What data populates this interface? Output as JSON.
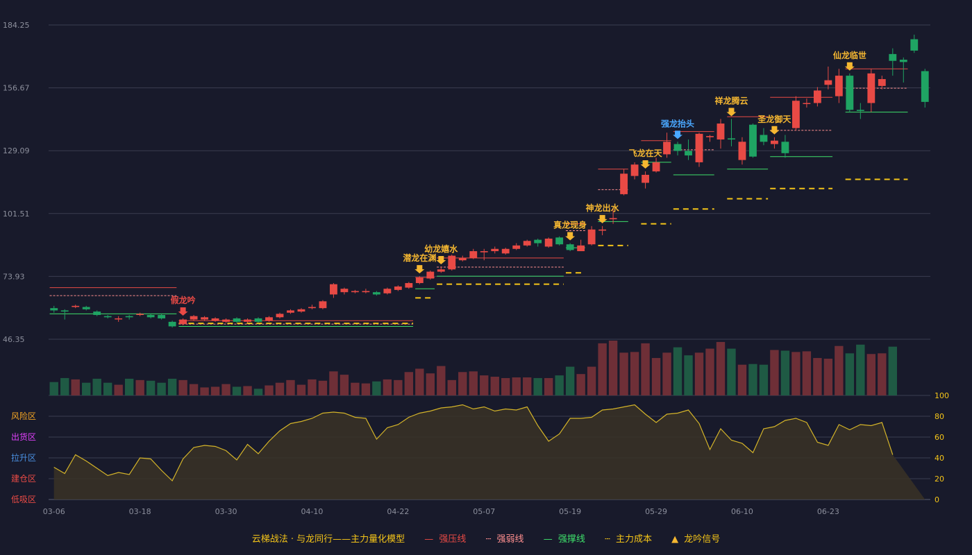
{
  "colors": {
    "up": "#e84a45",
    "down": "#1fa463",
    "signal": "#f5b731",
    "signal_alt": "#4aa8ff",
    "support": "#3ee06b",
    "cost": "#f5c518"
  },
  "chart_data": {
    "type": "candlestick",
    "price_axis": {
      "ticks": [
        46.35,
        73.93,
        101.51,
        129.09,
        156.67,
        184.25
      ],
      "range": [
        46.35,
        184.25
      ]
    },
    "osc_axis": {
      "ticks": [
        0,
        20,
        40,
        60,
        80,
        100
      ],
      "range": [
        0,
        100
      ]
    },
    "zones": [
      "风险区",
      "出货区",
      "拉升区",
      "建仓区",
      "低吸区"
    ],
    "x_ticks": [
      {
        "i": 0,
        "label": "03-06"
      },
      {
        "i": 8,
        "label": "03-18"
      },
      {
        "i": 16,
        "label": "03-30"
      },
      {
        "i": 24,
        "label": "04-10"
      },
      {
        "i": 32,
        "label": "04-22"
      },
      {
        "i": 40,
        "label": "05-07"
      },
      {
        "i": 48,
        "label": "05-19"
      },
      {
        "i": 56,
        "label": "05-29"
      },
      {
        "i": 64,
        "label": "06-10"
      },
      {
        "i": 72,
        "label": "06-23"
      }
    ],
    "candles": [
      [
        60.0,
        59.0,
        61.0,
        58.0
      ],
      [
        59.0,
        58.5,
        59.5,
        55.0
      ],
      [
        60.5,
        61.0,
        61.5,
        60.0
      ],
      [
        60.5,
        59.5,
        61.0,
        59.0
      ],
      [
        58.5,
        57.0,
        59.0,
        56.5
      ],
      [
        56.5,
        56.0,
        57.0,
        55.5
      ],
      [
        55.5,
        55.5,
        56.5,
        54.0
      ],
      [
        56.5,
        56.0,
        57.0,
        55.0
      ],
      [
        57.0,
        57.5,
        58.0,
        56.5
      ],
      [
        57.0,
        56.0,
        57.5,
        55.5
      ],
      [
        57.0,
        55.5,
        57.5,
        55.0
      ],
      [
        54.0,
        52.0,
        54.5,
        51.5
      ],
      [
        53.0,
        55.0,
        55.5,
        52.5
      ],
      [
        55.0,
        56.5,
        57.0,
        54.5
      ],
      [
        55.0,
        56.0,
        56.5,
        54.5
      ],
      [
        54.5,
        55.5,
        56.0,
        54.0
      ],
      [
        54.0,
        55.0,
        55.5,
        53.5
      ],
      [
        55.5,
        54.0,
        56.0,
        53.5
      ],
      [
        54.0,
        55.0,
        55.5,
        53.5
      ],
      [
        55.5,
        54.0,
        56.0,
        53.5
      ],
      [
        54.5,
        56.0,
        56.5,
        54.0
      ],
      [
        56.0,
        57.5,
        58.0,
        55.5
      ],
      [
        58.0,
        59.0,
        59.5,
        57.5
      ],
      [
        58.5,
        59.5,
        60.0,
        58.0
      ],
      [
        60.0,
        60.5,
        61.5,
        59.5
      ],
      [
        60.0,
        63.0,
        63.5,
        59.5
      ],
      [
        66.0,
        70.5,
        71.0,
        64.5
      ],
      [
        67.0,
        68.5,
        69.0,
        66.0
      ],
      [
        67.0,
        67.5,
        68.0,
        66.5
      ],
      [
        67.0,
        67.5,
        68.5,
        66.5
      ],
      [
        67.0,
        66.0,
        67.5,
        65.5
      ],
      [
        66.5,
        68.5,
        69.0,
        66.0
      ],
      [
        68.0,
        69.5,
        70.0,
        67.5
      ],
      [
        69.0,
        71.0,
        71.5,
        68.5
      ],
      [
        71.0,
        73.5,
        74.0,
        70.5
      ],
      [
        73.0,
        76.0,
        76.5,
        72.5
      ],
      [
        76.0,
        77.0,
        78.0,
        75.5
      ],
      [
        77.0,
        83.0,
        83.5,
        76.5
      ],
      [
        81.0,
        82.0,
        83.0,
        80.5
      ],
      [
        82.0,
        85.0,
        86.0,
        81.5
      ],
      [
        84.5,
        85.0,
        86.0,
        81.0
      ],
      [
        85.0,
        86.0,
        87.0,
        84.0
      ],
      [
        84.0,
        86.0,
        86.5,
        83.5
      ],
      [
        86.0,
        87.5,
        88.5,
        85.5
      ],
      [
        87.5,
        89.5,
        90.0,
        87.0
      ],
      [
        90.0,
        88.5,
        90.5,
        87.0
      ],
      [
        87.0,
        90.5,
        91.0,
        86.5
      ],
      [
        91.0,
        88.0,
        91.5,
        87.5
      ],
      [
        88.0,
        85.5,
        88.5,
        85.0
      ],
      [
        85.0,
        87.5,
        90.0,
        85.0
      ],
      [
        88.0,
        94.5,
        96.0,
        87.5
      ],
      [
        94.0,
        94.5,
        96.0,
        92.0
      ],
      [
        99.0,
        99.5,
        104.0,
        97.0
      ],
      [
        110.0,
        119.0,
        121.0,
        109.5
      ],
      [
        118.0,
        123.0,
        124.0,
        116.5
      ],
      [
        115.0,
        118.5,
        120.0,
        112.5
      ],
      [
        120.0,
        124.0,
        126.0,
        119.5
      ],
      [
        127.5,
        133.0,
        137.0,
        126.0
      ],
      [
        132.0,
        129.0,
        133.0,
        127.0
      ],
      [
        129.0,
        127.0,
        134.0,
        125.0
      ],
      [
        124.0,
        136.5,
        137.0,
        122.0
      ],
      [
        135.0,
        135.5,
        136.0,
        133.0
      ],
      [
        134.0,
        141.0,
        143.0,
        130.0
      ],
      [
        134.5,
        134.0,
        143.0,
        131.0
      ],
      [
        125.0,
        133.0,
        135.0,
        123.0
      ],
      [
        140.5,
        126.5,
        141.0,
        126.0
      ],
      [
        136.0,
        133.0,
        139.0,
        131.5
      ],
      [
        132.0,
        133.5,
        135.0,
        130.0
      ],
      [
        133.0,
        128.0,
        136.0,
        126.0
      ],
      [
        139.0,
        151.0,
        153.0,
        138.0
      ],
      [
        150.0,
        150.0,
        152.0,
        148.0
      ],
      [
        150.0,
        155.5,
        157.0,
        148.5
      ],
      [
        158.0,
        160.0,
        166.0,
        156.0
      ],
      [
        153.0,
        162.0,
        165.0,
        150.0
      ],
      [
        162.0,
        147.0,
        163.0,
        146.0
      ],
      [
        147.0,
        146.5,
        150.0,
        143.0
      ],
      [
        150.0,
        163.0,
        165.0,
        146.0
      ],
      [
        157.5,
        160.5,
        162.0,
        156.0
      ],
      [
        171.5,
        168.5,
        174.0,
        162.0
      ],
      [
        169.0,
        168.0,
        170.0,
        159.0
      ],
      [
        178.0,
        173.0,
        180.0,
        172.0
      ],
      [
        164.0,
        150.5,
        165.0,
        148.0
      ]
    ],
    "volume": [
      20,
      26,
      24,
      19,
      25,
      19,
      16,
      25,
      23,
      22,
      19,
      25,
      23,
      17,
      12,
      13,
      17,
      13,
      14,
      10,
      15,
      19,
      23,
      16,
      24,
      22,
      36,
      31,
      19,
      18,
      21,
      24,
      23,
      35,
      40,
      33,
      44,
      23,
      35,
      36,
      30,
      28,
      26,
      27,
      27,
      26,
      26,
      30,
      43,
      32,
      43,
      78,
      82,
      64,
      65,
      78,
      56,
      64,
      72,
      60,
      64,
      70,
      80,
      70,
      46,
      47,
      46,
      68,
      67,
      65,
      66,
      56,
      55,
      74,
      63,
      76,
      62,
      63,
      73
    ],
    "osc": [
      31,
      25,
      43,
      37,
      30,
      23,
      26,
      24,
      40,
      39,
      28,
      18,
      39,
      50,
      52,
      51,
      47,
      38,
      53,
      44,
      56,
      66,
      73,
      75,
      78,
      83,
      84,
      83,
      79,
      78,
      58,
      69,
      72,
      79,
      83,
      85,
      88,
      89,
      91,
      87,
      89,
      85,
      87,
      86,
      89,
      71,
      56,
      63,
      78,
      78,
      79,
      86,
      87,
      89,
      91,
      82,
      74,
      82,
      83,
      86,
      73,
      48,
      68,
      57,
      54,
      45,
      68,
      70,
      76,
      78,
      74,
      55,
      52,
      72,
      67,
      72,
      71,
      74,
      43
    ],
    "signals": [
      {
        "i": 12,
        "label": "假龙吟",
        "color": "#e84a45"
      },
      {
        "i": 34,
        "label": "潜龙在渊",
        "color": "#f5b731"
      },
      {
        "i": 36,
        "label": "幼龙嬉水",
        "color": "#f5b731"
      },
      {
        "i": 48,
        "label": "真龙现身",
        "color": "#f5b731"
      },
      {
        "i": 51,
        "label": "神龙出水",
        "color": "#f5b731"
      },
      {
        "i": 55,
        "label": "飞龙在天",
        "color": "#f5b731"
      },
      {
        "i": 58,
        "label": "强龙抬头",
        "color": "#4aa8ff"
      },
      {
        "i": 63,
        "label": "祥龙腾云",
        "color": "#f5b731"
      },
      {
        "i": 67,
        "label": "圣龙御天",
        "color": "#f5b731"
      },
      {
        "i": 74,
        "label": "仙龙临世",
        "color": "#f5b731"
      }
    ],
    "strong_lines": [
      [
        0,
        11,
        69.0,
        "#e84a45",
        "solid"
      ],
      [
        0,
        11,
        65.5,
        "#e84a45",
        "dashed"
      ],
      [
        0,
        11,
        57.5,
        "#3ee06b",
        "solid"
      ],
      [
        12,
        33,
        54.5,
        "#e84a45",
        "solid"
      ],
      [
        12,
        33,
        53.0,
        "#e84a45",
        "dashed"
      ],
      [
        12,
        33,
        52.0,
        "#3ee06b",
        "solid"
      ],
      [
        12,
        33,
        53.3,
        "#f5c518",
        "dashed"
      ],
      [
        34,
        35,
        73.5,
        "#e84a45",
        "solid"
      ],
      [
        34,
        35,
        68.5,
        "#3ee06b",
        "solid"
      ],
      [
        34,
        35,
        64.5,
        "#f5c518",
        "dashed"
      ],
      [
        36,
        47,
        82.0,
        "#e84a45",
        "solid"
      ],
      [
        36,
        47,
        78.0,
        "#e84a45",
        "dashed"
      ],
      [
        36,
        47,
        74.0,
        "#3ee06b",
        "solid"
      ],
      [
        36,
        47,
        70.5,
        "#f5c518",
        "dashed"
      ],
      [
        48,
        49,
        97.0,
        "#e84a45",
        "solid"
      ],
      [
        48,
        49,
        94.0,
        "#e84a45",
        "dashed"
      ],
      [
        48,
        49,
        86.5,
        "#3ee06b",
        "solid"
      ],
      [
        48,
        49,
        75.5,
        "#f5c518",
        "dashed"
      ],
      [
        51,
        53,
        121.0,
        "#e84a45",
        "solid"
      ],
      [
        51,
        53,
        112.0,
        "#e84a45",
        "dashed"
      ],
      [
        51,
        53,
        98.0,
        "#3ee06b",
        "solid"
      ],
      [
        51,
        53,
        87.5,
        "#f5c518",
        "dashed"
      ],
      [
        55,
        57,
        133.5,
        "#e84a45",
        "solid"
      ],
      [
        55,
        57,
        124.0,
        "#3ee06b",
        "solid"
      ],
      [
        55,
        57,
        97.0,
        "#f5c518",
        "dashed"
      ],
      [
        58,
        61,
        137.5,
        "#e84a45",
        "solid"
      ],
      [
        58,
        61,
        129.5,
        "#e84a45",
        "dashed"
      ],
      [
        58,
        61,
        118.5,
        "#3ee06b",
        "solid"
      ],
      [
        58,
        61,
        103.5,
        "#f5c518",
        "dashed"
      ],
      [
        63,
        66,
        144.0,
        "#e84a45",
        "solid"
      ],
      [
        63,
        66,
        121.0,
        "#3ee06b",
        "solid"
      ],
      [
        63,
        66,
        108.0,
        "#f5c518",
        "dashed"
      ],
      [
        67,
        72,
        152.5,
        "#e84a45",
        "solid"
      ],
      [
        67,
        72,
        138.0,
        "#e84a45",
        "dashed"
      ],
      [
        67,
        72,
        126.5,
        "#3ee06b",
        "solid"
      ],
      [
        67,
        72,
        112.5,
        "#f5c518",
        "dashed"
      ],
      [
        74,
        79,
        165.0,
        "#e84a45",
        "solid"
      ],
      [
        74,
        79,
        156.5,
        "#e84a45",
        "dashed"
      ],
      [
        74,
        79,
        146.0,
        "#3ee06b",
        "solid"
      ],
      [
        74,
        79,
        116.5,
        "#f5c518",
        "dashed"
      ]
    ]
  },
  "legend": {
    "title": "云梯战法 · 与龙同行——主力量化模型",
    "items": [
      {
        "symbol": "—",
        "label": "强压线",
        "color": "#e84a45"
      },
      {
        "symbol": "┄",
        "label": "强弱线",
        "color": "#ff8f8f"
      },
      {
        "symbol": "—",
        "label": "强撑线",
        "color": "#3ee06b"
      },
      {
        "symbol": "┄",
        "label": "主力成本",
        "color": "#f5c518"
      },
      {
        "symbol": "▲",
        "label": "龙吟信号",
        "color": "#f5b731"
      }
    ]
  }
}
